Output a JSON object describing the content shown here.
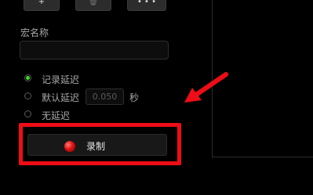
{
  "toolbar": {
    "add": "+",
    "delete": "🗑",
    "more": "• • •"
  },
  "macro_name": {
    "label": "宏名称",
    "value": ""
  },
  "delay_options": [
    {
      "label": "记录延迟",
      "selected": true
    },
    {
      "label": "默认延迟",
      "selected": false
    },
    {
      "label": "无延迟",
      "selected": false
    }
  ],
  "default_delay": {
    "placeholder": "0.050",
    "unit": "秒"
  },
  "record": {
    "label": "录制",
    "dot_color": "#e01010"
  },
  "colors": {
    "accent": "#44d62c",
    "highlight": "#ee0d16"
  }
}
